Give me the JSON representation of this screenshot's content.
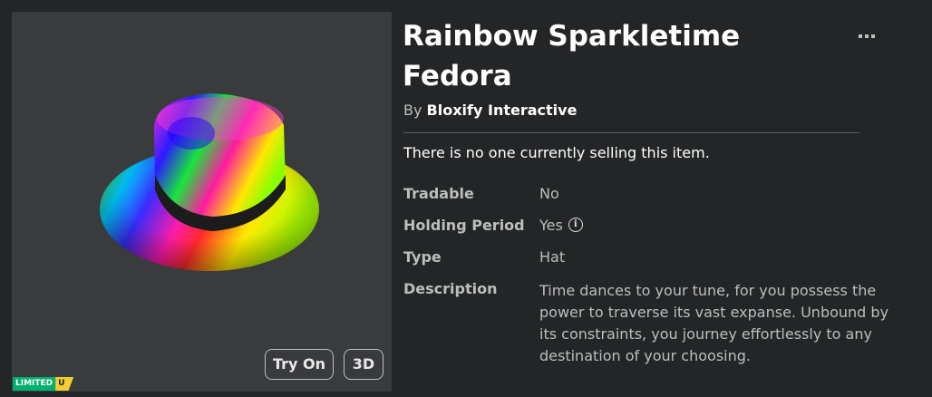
{
  "item": {
    "title": "Rainbow Sparkletime Fedora",
    "by_label": "By",
    "creator": "Bloxify Interactive",
    "selling_status": "There is no one currently selling this item.",
    "badge": {
      "label": "LIMITED",
      "suffix": "U"
    }
  },
  "thumbnail": {
    "try_on_label": "Try On",
    "view_3d_label": "3D"
  },
  "details": [
    {
      "key": "Tradable",
      "value": "No"
    },
    {
      "key": "Holding Period",
      "value": "Yes"
    },
    {
      "key": "Type",
      "value": "Hat"
    },
    {
      "key": "Description",
      "value": "Time dances to your tune, for you possess the power to traverse its vast expanse. Unbound by its constraints, you journey effortlessly to any destination of your choosing."
    }
  ],
  "icons": {
    "more": "more-horizontal-icon",
    "info": "info-icon"
  },
  "colors": {
    "background": "#232527",
    "panel": "#393b3d",
    "limited": "#00b06f",
    "unique": "#f5cd30"
  }
}
